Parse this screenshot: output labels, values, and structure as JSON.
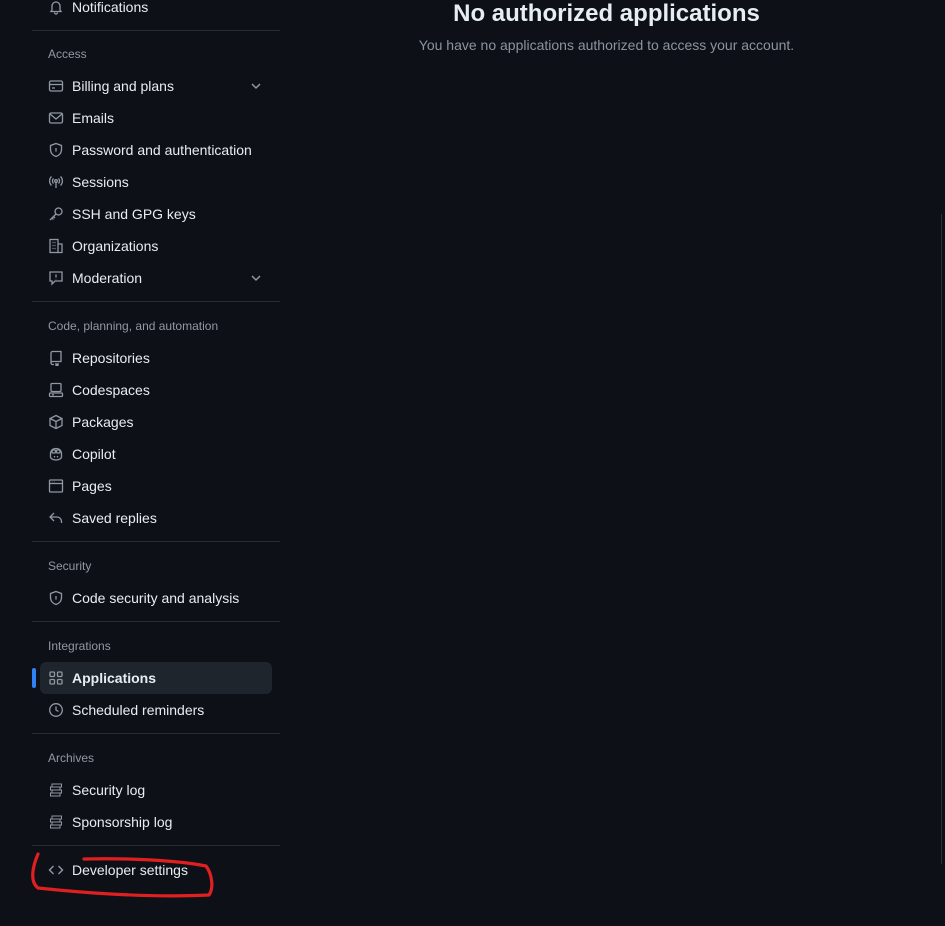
{
  "main": {
    "title": "No authorized applications",
    "description": "You have no applications authorized to access your account."
  },
  "sidebar": {
    "top_item": {
      "label": "Notifications",
      "icon": "bell-icon"
    },
    "sections": {
      "access": {
        "heading": "Access",
        "items": [
          {
            "label": "Billing and plans",
            "icon": "credit-card-icon",
            "expandable": true
          },
          {
            "label": "Emails",
            "icon": "mail-icon"
          },
          {
            "label": "Password and authentication",
            "icon": "shield-lock-icon"
          },
          {
            "label": "Sessions",
            "icon": "broadcast-icon"
          },
          {
            "label": "SSH and GPG keys",
            "icon": "key-icon"
          },
          {
            "label": "Organizations",
            "icon": "organization-icon"
          },
          {
            "label": "Moderation",
            "icon": "report-icon",
            "expandable": true
          }
        ]
      },
      "code": {
        "heading": "Code, planning, and automation",
        "items": [
          {
            "label": "Repositories",
            "icon": "repo-icon"
          },
          {
            "label": "Codespaces",
            "icon": "codespaces-icon"
          },
          {
            "label": "Packages",
            "icon": "package-icon"
          },
          {
            "label": "Copilot",
            "icon": "copilot-icon"
          },
          {
            "label": "Pages",
            "icon": "browser-icon"
          },
          {
            "label": "Saved replies",
            "icon": "reply-icon"
          }
        ]
      },
      "security": {
        "heading": "Security",
        "items": [
          {
            "label": "Code security and analysis",
            "icon": "codescan-icon"
          }
        ]
      },
      "integrations": {
        "heading": "Integrations",
        "items": [
          {
            "label": "Applications",
            "icon": "apps-icon",
            "active": true
          },
          {
            "label": "Scheduled reminders",
            "icon": "clock-icon"
          }
        ]
      },
      "archives": {
        "heading": "Archives",
        "items": [
          {
            "label": "Security log",
            "icon": "log-icon"
          },
          {
            "label": "Sponsorship log",
            "icon": "log-icon"
          }
        ]
      }
    },
    "bottom_item": {
      "label": "Developer settings",
      "icon": "code-icon"
    }
  },
  "colors": {
    "background": "#0d1117",
    "text": "#e6edf3",
    "muted": "#9198a1",
    "active_bg": "#1f252d",
    "accent": "#2f81f7",
    "annotation": "#e02020"
  }
}
